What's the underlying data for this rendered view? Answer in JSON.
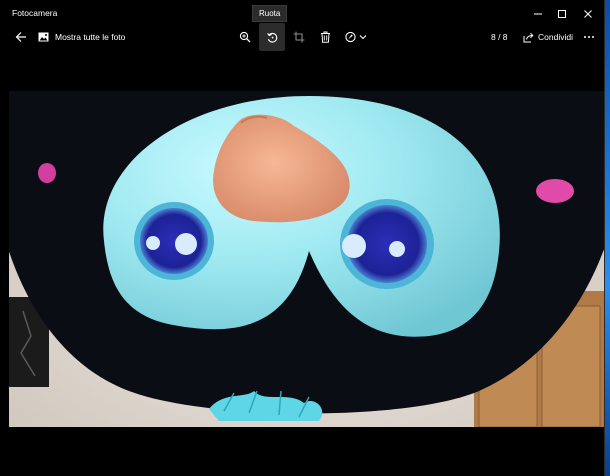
{
  "window": {
    "title": "Fotocamera"
  },
  "toolbar": {
    "show_all_label": "Mostra tutte le foto",
    "tooltip": "Ruota",
    "counter": "8 / 8",
    "share_label": "Condividi"
  },
  "icons": {
    "back": "back-arrow-icon",
    "gallery": "image-icon",
    "zoom": "zoom-in-icon",
    "rotate": "rotate-icon",
    "crop": "crop-icon",
    "delete": "trash-icon",
    "edit": "edit-create-icon",
    "share": "share-icon",
    "more": "more-icon"
  },
  "colors": {
    "window_bg": "#000000",
    "toolbar_text": "#ffffff",
    "tooltip_bg": "#2b2b2b",
    "desktop": "#1e6fd0"
  }
}
